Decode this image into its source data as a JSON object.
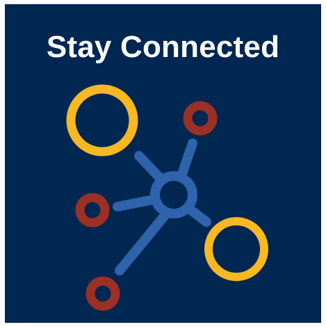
{
  "title": "Stay Connected",
  "colors": {
    "background": "#002652",
    "hub": "#2f63ab",
    "large_ring": "#f7b822",
    "small_ring": "#9b3025",
    "title_text": "#ffffff"
  },
  "icons": [
    "network-hub-icon"
  ]
}
